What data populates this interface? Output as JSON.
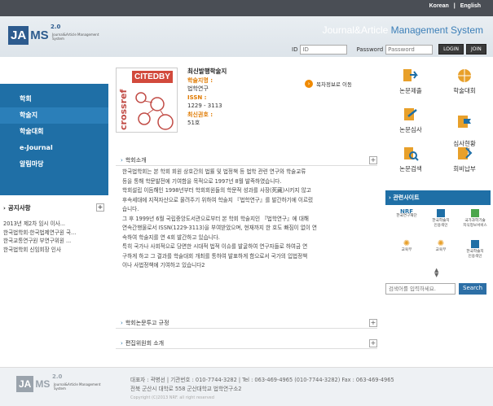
{
  "topbar": {
    "lang_ko": "Korean",
    "sep": "|",
    "lang_en": "English"
  },
  "header": {
    "logo_ja": "JA",
    "logo_ms": "MS",
    "logo_ver": "2.0",
    "logo_sub": "Journal&Article Management System",
    "sys_a": "Journal&Article",
    "sys_b": " Management System"
  },
  "login": {
    "id_label": "ID",
    "id_placeholder": "ID",
    "pw_label": "Password",
    "pw_placeholder": "Password",
    "login_btn": "LOGIN",
    "join_btn": "JOIN"
  },
  "nav": [
    "학회",
    "학술지",
    "학술대회",
    "e-Journal",
    "알림마당"
  ],
  "notice": {
    "title": "공지사항",
    "items": [
      "2013년 제2차 임시 이사...",
      "한국법학회·한국법제연구원 국...",
      "한국교통연구원 부연구위원 ...",
      "한국법학회 신임회장 인사"
    ]
  },
  "journal": {
    "cover_side": "crossref",
    "cover_top": "CITEDBY",
    "title": "최신발행학술지",
    "name_label": "학술지명 :",
    "name": "법학연구",
    "issn_label": "ISSN :",
    "issn": "1229 - 3113",
    "issue_label": "최신권호 :",
    "issue": "51호",
    "toc_link": "목차정보로 이동"
  },
  "sections": {
    "intro": "학회소개",
    "rules": "학회논문투고 규정",
    "board": "편집위원회 소개"
  },
  "intro_text": [
    "한국법학회는 본 학회 회원 상호간의 법률 및 법정책 등 법학 관련 연구와 학술교류",
    "등을 통해 학문발전에 기여함을 목적으로 1997년 8월 발족하였습니다.",
    "학회설립 이듬해인 1998년부터 학회회원들의 학문적 성과를 사장(死藏)시키지 않고",
    "후속세대에 지적자산으로 물려주기 위하여 학술지 『법학연구』를 발간하기에 이르렀",
    "습니다.",
    "그 후 1999년 6월 국립중앙도서관으로부터 본 학회 학술지인 『법학연구』에 대해",
    "연속간행물로서 ISSN(1229-3113)을 부여받았으며, 현재까지 한 호도 빠짐이 없이 연",
    "속하여 학술지를 연 4회 발간하고 있습니다.",
    "특히 국가나 사회적으로 당면한 시대적 법적 이슈를 발굴하여 연구자들로 하여금 연",
    "구하게 하고 그 결과를 학술대회 개최를 통하여 발표하게 함으로서 국가의 입법정책",
    "이나 사법정책에 기여하고 있습니다2"
  ],
  "quick": [
    "논문제출",
    "학술대회",
    "논문심사",
    "심사현황\n조회",
    "논문검색",
    "회비납부"
  ],
  "related": {
    "title": "관련사이트",
    "orgs": [
      "한국연구재단",
      "한국학술지\n인용색인",
      "국가과학기술\n지식정보서비스",
      "교육부",
      "교육부",
      "한국학술지\n인용색인"
    ]
  },
  "search": {
    "placeholder": "검색어를 입력하세요.",
    "button": "Search"
  },
  "footer": {
    "line1": "대표자 : 곽병선 | 기관번호 : 010-7744-3282 | Tel : 063-469-4965 (010-7744-3282) Fax : 063-469-4965",
    "line2": "전북 군산시 대학로 558 군산대학교 법학연구소2",
    "line3": "Copyright (C)2013 NRF. all right reserved"
  },
  "colors": {
    "primary": "#1f6fa6",
    "accent": "#e07a00",
    "topbar": "#4a4e55"
  }
}
